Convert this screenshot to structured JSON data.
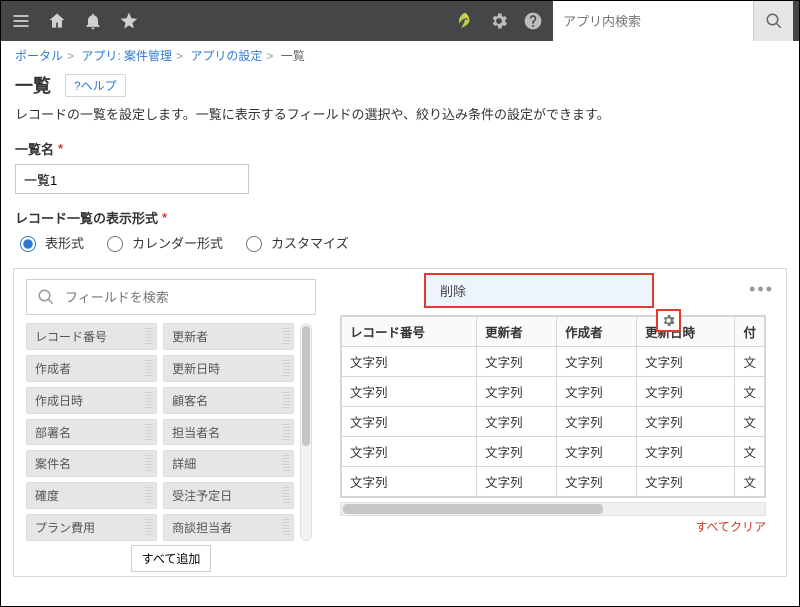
{
  "topbar": {
    "search_placeholder": "アプリ内検索"
  },
  "breadcrumb": {
    "portal": "ポータル",
    "app": "アプリ: 案件管理",
    "settings": "アプリの設定",
    "current": "一覧"
  },
  "heading": {
    "title": "一覧",
    "help": "?ヘルプ"
  },
  "description": "レコードの一覧を設定します。一覧に表示するフィールドの選択や、絞り込み条件の設定ができます。",
  "name_section": {
    "label": "一覧名",
    "value": "一覧1"
  },
  "display_section": {
    "label": "レコード一覧の表示形式",
    "options": {
      "table": "表形式",
      "calendar": "カレンダー形式",
      "custom": "カスタマイズ"
    }
  },
  "field_picker": {
    "search_placeholder": "フィールドを検索",
    "left": [
      "レコード番号",
      "作成者",
      "作成日時",
      "部署名",
      "案件名",
      "確度",
      "プラン費用"
    ],
    "right": [
      "更新者",
      "更新日時",
      "顧客名",
      "担当者名",
      "詳細",
      "受注予定日",
      "商談担当者"
    ],
    "add_all": "すべて追加"
  },
  "popup": {
    "delete": "削除"
  },
  "preview": {
    "headers": [
      "レコード番号",
      "更新者",
      "作成者",
      "更新日時",
      "付"
    ],
    "cell": "文字列",
    "clear_all": "すべてクリア"
  }
}
